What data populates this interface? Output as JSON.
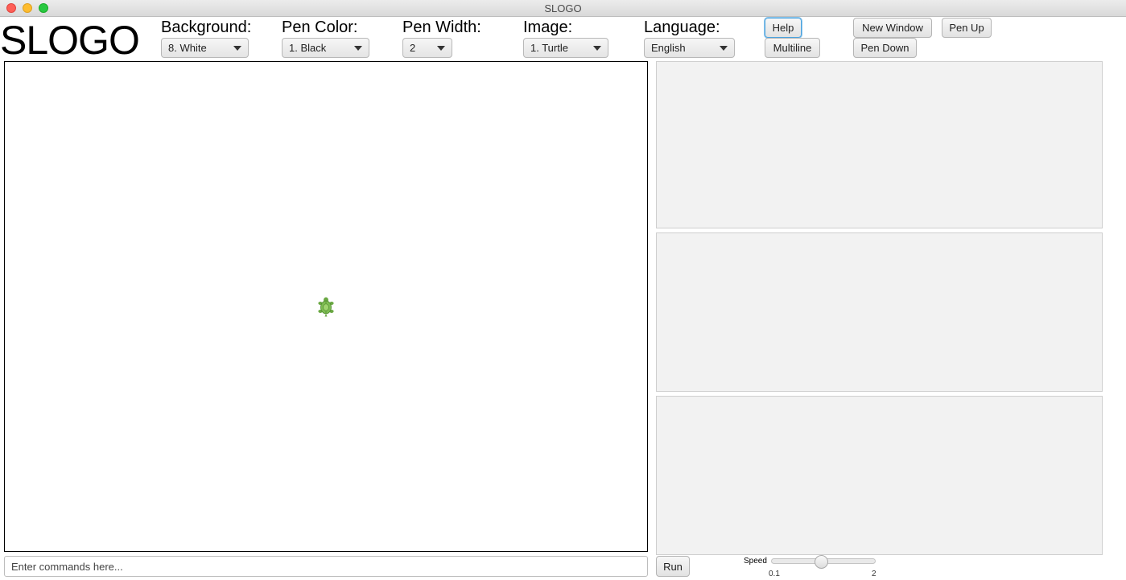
{
  "window": {
    "title": "SLOGO"
  },
  "app": {
    "title": "SLOGO"
  },
  "controls": {
    "background": {
      "label": "Background:",
      "value": "8. White"
    },
    "pen_color": {
      "label": "Pen Color:",
      "value": "1. Black"
    },
    "pen_width": {
      "label": "Pen Width:",
      "value": "2"
    },
    "image": {
      "label": "Image:",
      "value": "1. Turtle"
    },
    "language": {
      "label": "Language:",
      "value": "English"
    }
  },
  "buttons": {
    "help": "Help",
    "multiline": "Multiline",
    "new_window": "New Window",
    "pen_down": "Pen Down",
    "pen_up": "Pen Up",
    "run": "Run"
  },
  "command": {
    "placeholder": "Enter commands here..."
  },
  "speed": {
    "label": "Speed",
    "min": "0.1",
    "max": "2",
    "value": 0.9
  },
  "icons": {
    "turtle": "turtle-icon"
  },
  "colors": {
    "canvas_background": "#ffffff",
    "turtle": "#7dbb52",
    "focus_ring": "#4aa3df"
  }
}
